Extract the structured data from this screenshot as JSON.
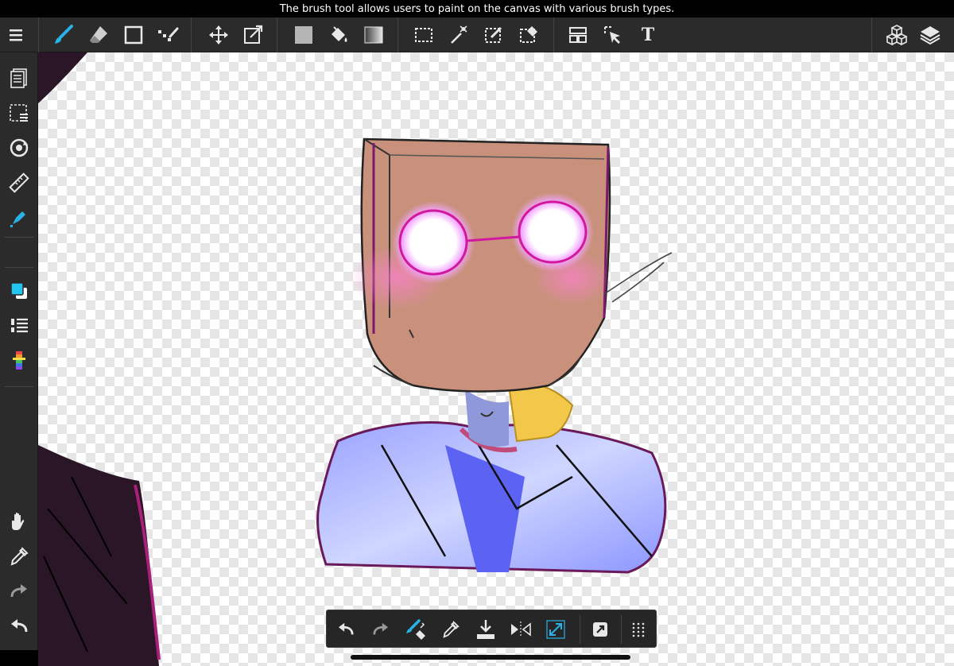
{
  "status": {
    "tooltip": "The brush tool allows users to paint on the canvas with various brush types."
  },
  "toolbar": {
    "text_tool_label": "T",
    "items": [
      {
        "name": "menu",
        "icon": "menu-icon"
      },
      {
        "name": "brush",
        "icon": "brush-icon",
        "active": true
      },
      {
        "name": "eraser",
        "icon": "eraser-icon"
      },
      {
        "name": "shape",
        "icon": "rectangle-icon"
      },
      {
        "name": "filter",
        "icon": "filter-icon"
      },
      {
        "name": "move",
        "icon": "move-icon"
      },
      {
        "name": "transform",
        "icon": "transform-icon"
      },
      {
        "name": "fill-color",
        "icon": "fill-swatch-icon"
      },
      {
        "name": "bucket",
        "icon": "paint-bucket-icon"
      },
      {
        "name": "gradient",
        "icon": "gradient-icon"
      },
      {
        "name": "select-rect",
        "icon": "select-rectangle-icon"
      },
      {
        "name": "magic-wand",
        "icon": "magic-wand-icon"
      },
      {
        "name": "select-pen",
        "icon": "select-pen-icon"
      },
      {
        "name": "select-eraser",
        "icon": "select-eraser-icon"
      },
      {
        "name": "frame-divider",
        "icon": "frame-divider-icon"
      },
      {
        "name": "operation",
        "icon": "operation-cursor-icon"
      },
      {
        "name": "text",
        "icon": "text-icon"
      },
      {
        "name": "materials",
        "icon": "materials-cubes-icon"
      },
      {
        "name": "layers",
        "icon": "layers-icon"
      }
    ]
  },
  "sidebar": {
    "items": [
      {
        "name": "pages",
        "icon": "pages-icon"
      },
      {
        "name": "selection-list",
        "icon": "selection-list-icon"
      },
      {
        "name": "rotate-canvas",
        "icon": "rotate-icon"
      },
      {
        "name": "ruler",
        "icon": "ruler-icon"
      },
      {
        "name": "snap-pen",
        "icon": "snap-pen-icon"
      },
      {
        "name": "color",
        "icon": "color-swatch-icon"
      },
      {
        "name": "brush-list",
        "icon": "brush-list-icon"
      },
      {
        "name": "color-palette",
        "icon": "color-palette-icon"
      },
      {
        "name": "hand",
        "icon": "hand-icon"
      },
      {
        "name": "eyedropper",
        "icon": "eyedropper-icon"
      },
      {
        "name": "redo",
        "icon": "redo-icon"
      },
      {
        "name": "undo",
        "icon": "undo-icon"
      }
    ],
    "colors": {
      "main": "#22c4f0",
      "sub": "#ffffff"
    }
  },
  "bottombar": {
    "items": [
      {
        "name": "undo",
        "icon": "undo-icon"
      },
      {
        "name": "redo",
        "icon": "redo-icon"
      },
      {
        "name": "brush-eraser-toggle",
        "icon": "brush-eraser-icon"
      },
      {
        "name": "eyedropper",
        "icon": "eyedropper-icon"
      },
      {
        "name": "import",
        "icon": "import-icon"
      },
      {
        "name": "flip",
        "icon": "flip-horizontal-icon"
      },
      {
        "name": "fit-screen",
        "icon": "fit-screen-icon"
      },
      {
        "name": "share",
        "icon": "share-icon"
      },
      {
        "name": "more",
        "icon": "grid-dots-icon"
      }
    ]
  },
  "colors": {
    "accent": "#2ab2e8",
    "toolbar_bg": "#2b2b2b",
    "icon": "#e0e0e0"
  }
}
